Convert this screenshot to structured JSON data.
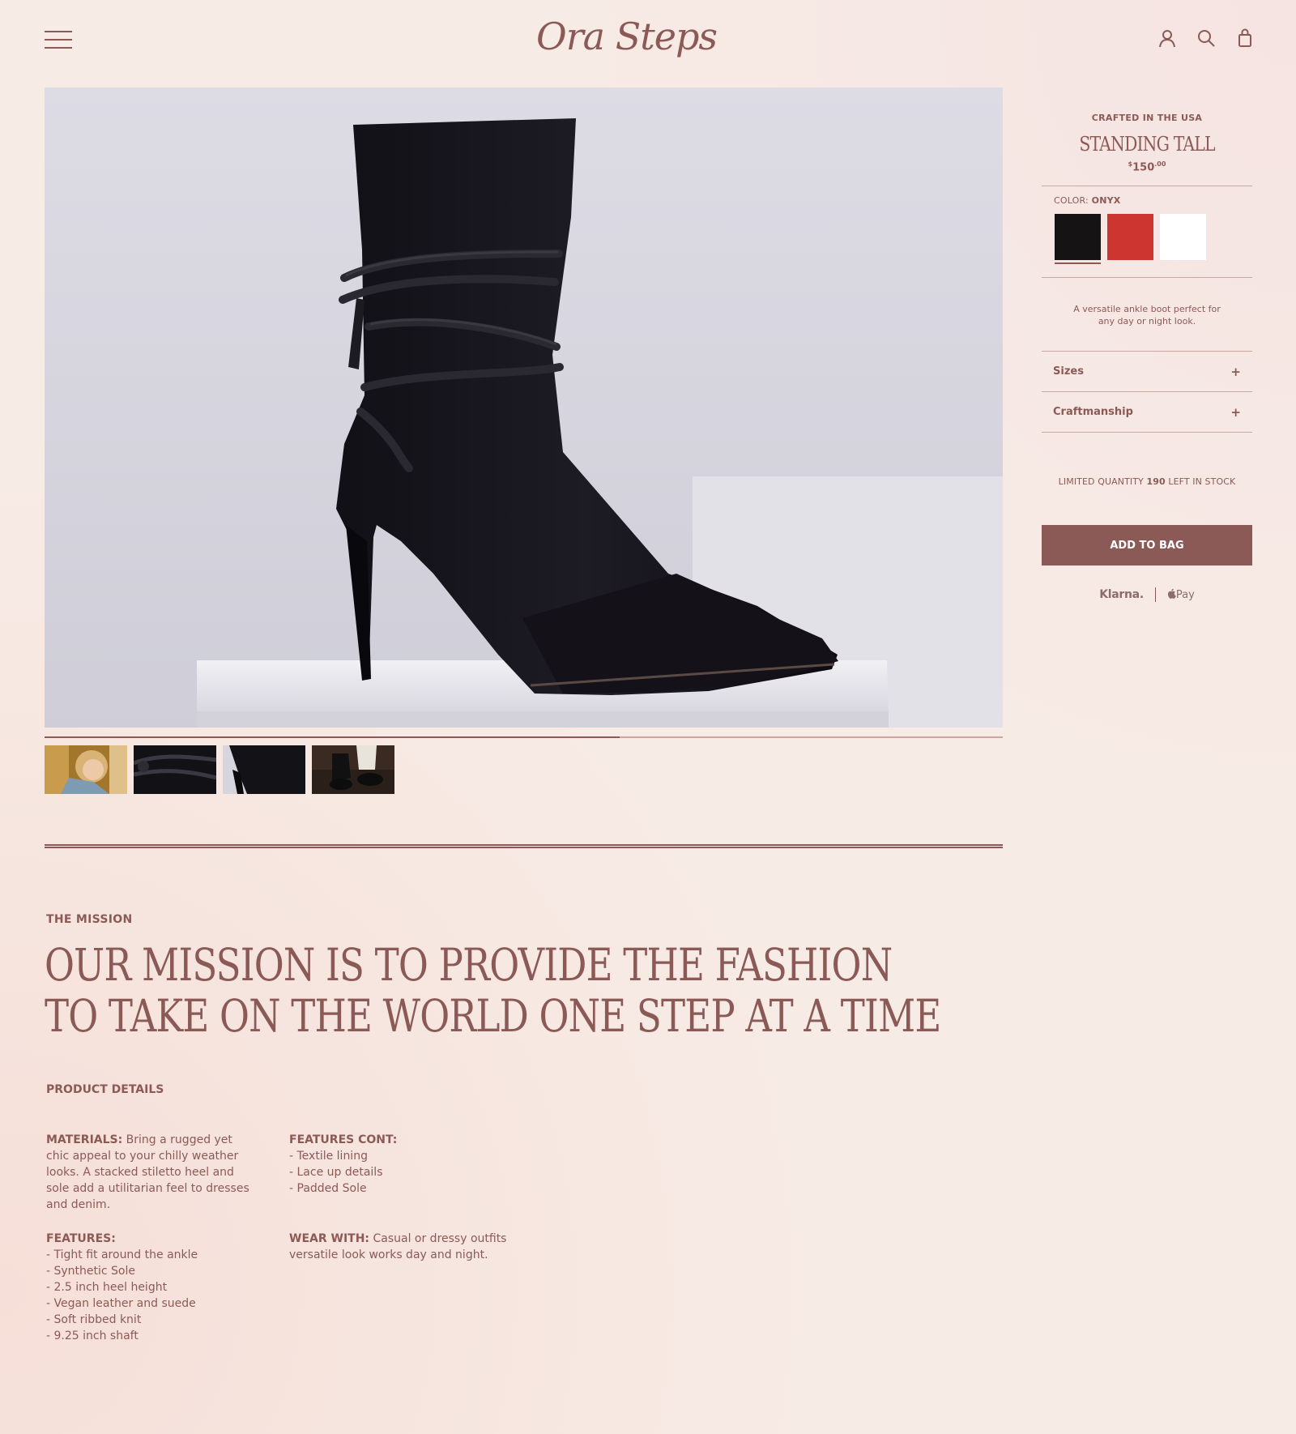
{
  "header": {
    "logo": "Ora Steps",
    "icons": [
      "menu-icon",
      "account-icon",
      "search-icon",
      "bag-icon"
    ]
  },
  "gallery": {
    "progress": 0.6,
    "thumbnails": [
      "thumb-model",
      "thumb-straps",
      "thumb-heel",
      "thumb-lifestyle"
    ]
  },
  "mission": {
    "label": "THE MISSION",
    "headline_line1": "OUR MISSION IS TO PROVIDE THE FASHION",
    "headline_line2": "TO TAKE ON THE WORLD ONE STEP AT A TIME"
  },
  "product_details": {
    "label": "PRODUCT DETAILS",
    "materials_label": "MATERIALS:",
    "materials_text": " Bring a rugged yet chic appeal to your chilly weather looks. A stacked stiletto heel and sole add a utilitarian feel to dresses and denim.",
    "features_label": "FEATURES:",
    "features": [
      "- Tight fit around the ankle",
      "- Synthetic Sole",
      "- 2.5 inch heel height",
      "- Vegan leather and suede",
      "- Soft ribbed knit",
      "- 9.25 inch shaft"
    ],
    "features_cont_label": "FEATURES CONT:",
    "features_cont": [
      "- Textile lining",
      "- Lace up details",
      "- Padded Sole"
    ],
    "wear_with_label": "WEAR WITH:",
    "wear_with_text": " Casual or dressy outfits versatile look works day and night."
  },
  "product": {
    "crafted": "CRAFTED IN THE USA",
    "name": "STANDING TALL",
    "price_currency": "$",
    "price_main": "150",
    "price_cents": ".00",
    "color_label": "COLOR: ",
    "color_value": "ONYX",
    "swatches": [
      {
        "name": "Onyx",
        "hex": "#151313"
      },
      {
        "name": "Red",
        "hex": "#cc3530"
      },
      {
        "name": "White",
        "hex": "#ffffff"
      }
    ],
    "description": "A versatile ankle boot perfect for any day or night look.",
    "accordion": [
      "Sizes",
      "Craftmanship"
    ],
    "accordion_icon": "+",
    "stock_prefix": "LIMITED QUANTITY ",
    "stock_count": "190",
    "stock_suffix": " LEFT IN STOCK",
    "add_to_bag": "ADD TO BAG",
    "pay_klarna": "Klarna.",
    "pay_apple": "Pay"
  },
  "colors": {
    "accent": "#8b5a56",
    "background": "#f7ebe5"
  }
}
